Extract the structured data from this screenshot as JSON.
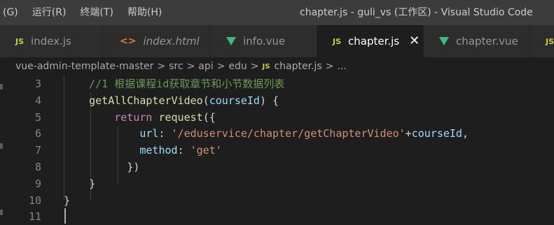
{
  "menu": [
    {
      "label": "(G)"
    },
    {
      "label": "运行(R)"
    },
    {
      "label": "终端(T)"
    },
    {
      "label": "帮助(H)"
    }
  ],
  "window_title": "chapter.js - guli_vs (工作区) - Visual Studio Code",
  "tabs": [
    {
      "label": "index.js",
      "icon": "JS",
      "type": "js"
    },
    {
      "label": "index.html",
      "icon": "<>",
      "type": "html"
    },
    {
      "label": "info.vue",
      "icon": "V",
      "type": "vue"
    },
    {
      "label": "chapter.js",
      "icon": "JS",
      "type": "js",
      "active": true
    },
    {
      "label": "chapter.vue",
      "icon": "V",
      "type": "vue"
    },
    {
      "label": "",
      "icon": "JS",
      "type": "js"
    }
  ],
  "close_glyph": "✕",
  "breadcrumb": {
    "items": [
      "vue-admin-template-master",
      "src",
      "api",
      "edu"
    ],
    "file_icon": "JS",
    "file": "chapter.js",
    "ellipsis": "...",
    "separator": ">"
  },
  "code": {
    "lines": [
      {
        "n": "3",
        "indent": "    ",
        "tokens": [
          {
            "t": "//1 根据课程id获取章节和小节数据列表",
            "c": "comment"
          }
        ]
      },
      {
        "n": "4",
        "indent": "    ",
        "tokens": [
          {
            "t": "getAllChapterVideo",
            "c": "func"
          },
          {
            "t": "(",
            "c": "punc"
          },
          {
            "t": "courseId",
            "c": "param"
          },
          {
            "t": ") {",
            "c": "punc"
          }
        ]
      },
      {
        "n": "5",
        "indent": "        ",
        "tokens": [
          {
            "t": "return",
            "c": "kw"
          },
          {
            "t": " ",
            "c": "punc"
          },
          {
            "t": "request",
            "c": "func"
          },
          {
            "t": "({",
            "c": "punc"
          }
        ]
      },
      {
        "n": "6",
        "indent": "            ",
        "tokens": [
          {
            "t": "url",
            "c": "param"
          },
          {
            "t": ": ",
            "c": "punc"
          },
          {
            "t": "'/eduservice/chapter/getChapterVideo'",
            "c": "str"
          },
          {
            "t": "+",
            "c": "punc"
          },
          {
            "t": "courseId",
            "c": "param"
          },
          {
            "t": ",",
            "c": "punc"
          }
        ]
      },
      {
        "n": "7",
        "indent": "            ",
        "tokens": [
          {
            "t": "method",
            "c": "param"
          },
          {
            "t": ": ",
            "c": "punc"
          },
          {
            "t": "'get'",
            "c": "str"
          }
        ]
      },
      {
        "n": "8",
        "indent": "          ",
        "tokens": [
          {
            "t": "})",
            "c": "punc"
          }
        ]
      },
      {
        "n": "9",
        "indent": "    ",
        "tokens": [
          {
            "t": "}",
            "c": "punc"
          }
        ]
      },
      {
        "n": "10",
        "indent": "",
        "tokens": [
          {
            "t": "}",
            "c": "punc"
          }
        ]
      },
      {
        "n": "11",
        "indent": "",
        "tokens": []
      }
    ]
  },
  "colors": {
    "comment": "#6a9955",
    "func": "#dcdcaa",
    "param": "#9cdcfe",
    "kw": "#c586c0",
    "str": "#ce9178",
    "punc": "#d4d4d4"
  }
}
